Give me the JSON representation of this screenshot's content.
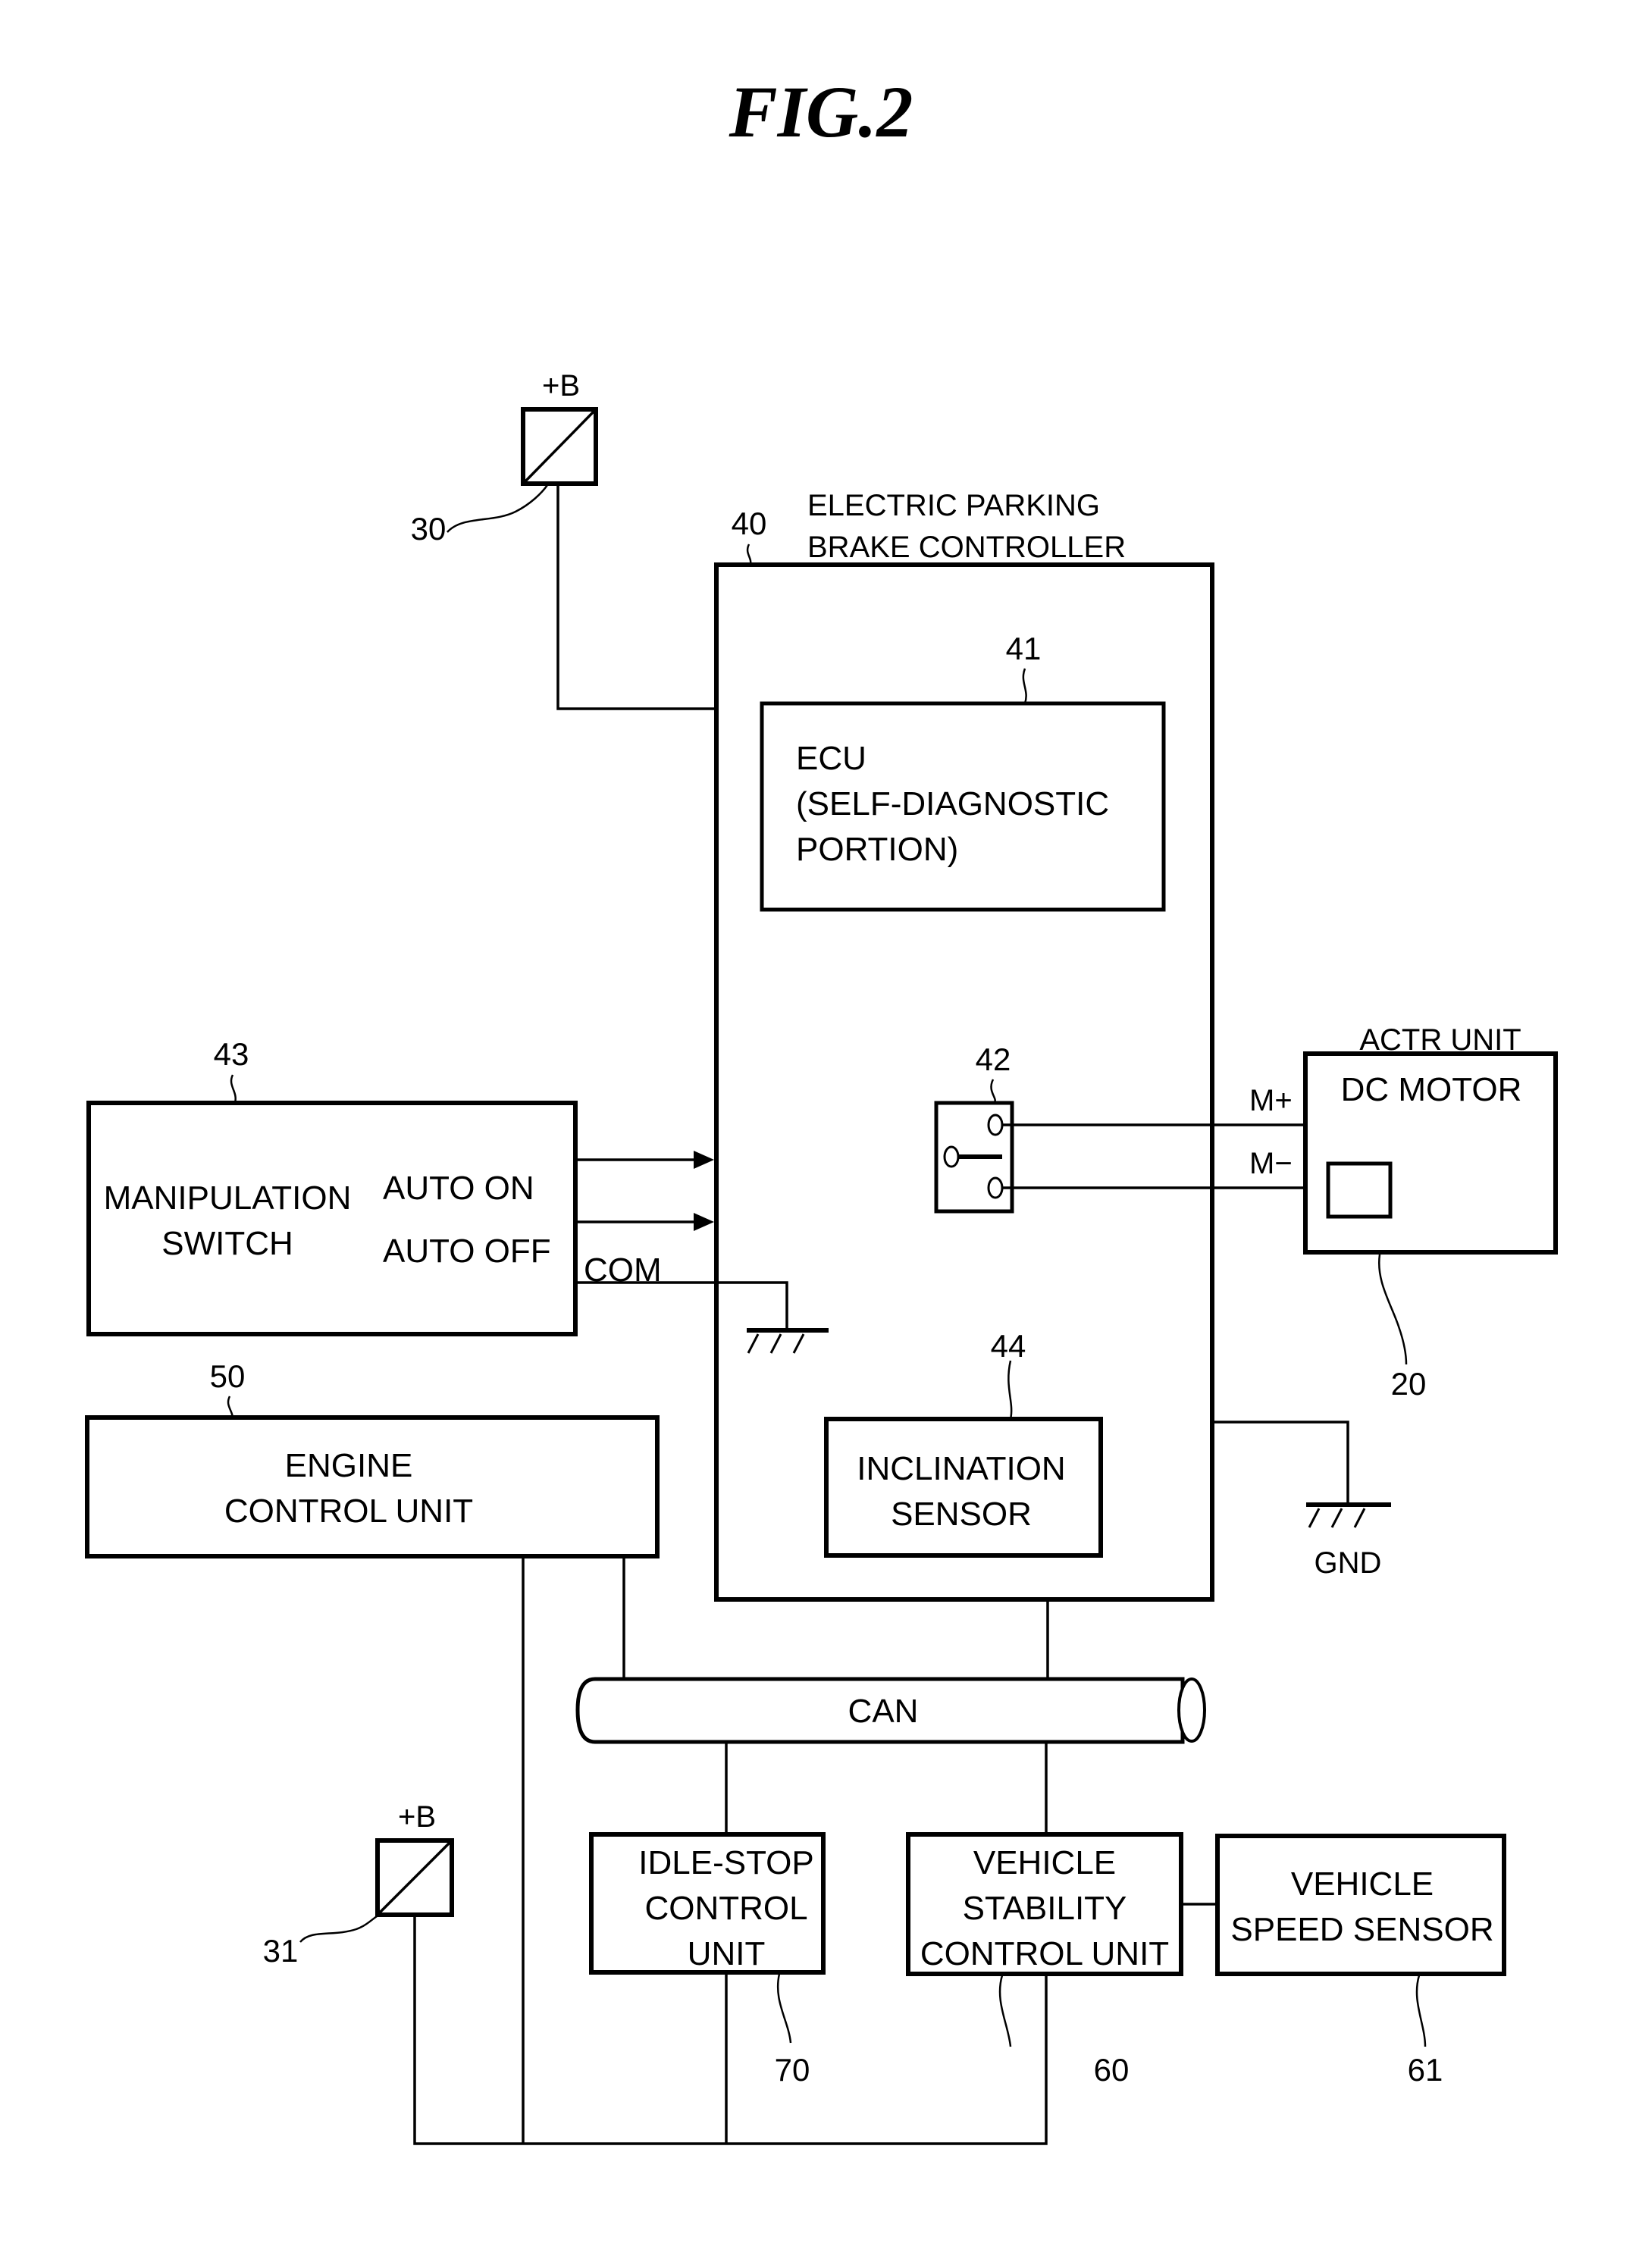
{
  "figure": {
    "title": "FIG.2"
  },
  "power_supplies": [
    {
      "id": "30",
      "label": "+B"
    },
    {
      "id": "31",
      "label": "+B"
    }
  ],
  "controller": {
    "id": "40",
    "title_line1": "ELECTRIC PARKING",
    "title_line2": "BRAKE CONTROLLER",
    "ecu": {
      "id": "41",
      "lines": [
        "ECU",
        "(SELF-DIAGNOSTIC",
        "PORTION)"
      ]
    },
    "relay": {
      "id": "42"
    },
    "inclination_sensor": {
      "id": "44",
      "lines": [
        "INCLINATION",
        "SENSOR"
      ]
    }
  },
  "manipulation_switch": {
    "id": "43",
    "lines": [
      "MANIPULATION",
      "SWITCH"
    ],
    "outputs": [
      "AUTO ON",
      "AUTO OFF"
    ],
    "common": "COM"
  },
  "actuator": {
    "id": "20",
    "unit_label": "ACTR UNIT",
    "motor_label": "DC MOTOR",
    "terminals": [
      "M+",
      "M−"
    ]
  },
  "ground": {
    "label": "GND"
  },
  "engine_control_unit": {
    "id": "50",
    "lines": [
      "ENGINE",
      "CONTROL UNIT"
    ]
  },
  "can_bus": {
    "label": "CAN"
  },
  "idle_stop_unit": {
    "id": "70",
    "lines": [
      "IDLE-STOP",
      "CONTROL",
      "UNIT"
    ]
  },
  "stability_unit": {
    "id": "60",
    "lines": [
      "VEHICLE",
      "STABILITY",
      "CONTROL UNIT"
    ]
  },
  "speed_sensor": {
    "id": "61",
    "lines": [
      "VEHICLE",
      "SPEED SENSOR"
    ]
  }
}
